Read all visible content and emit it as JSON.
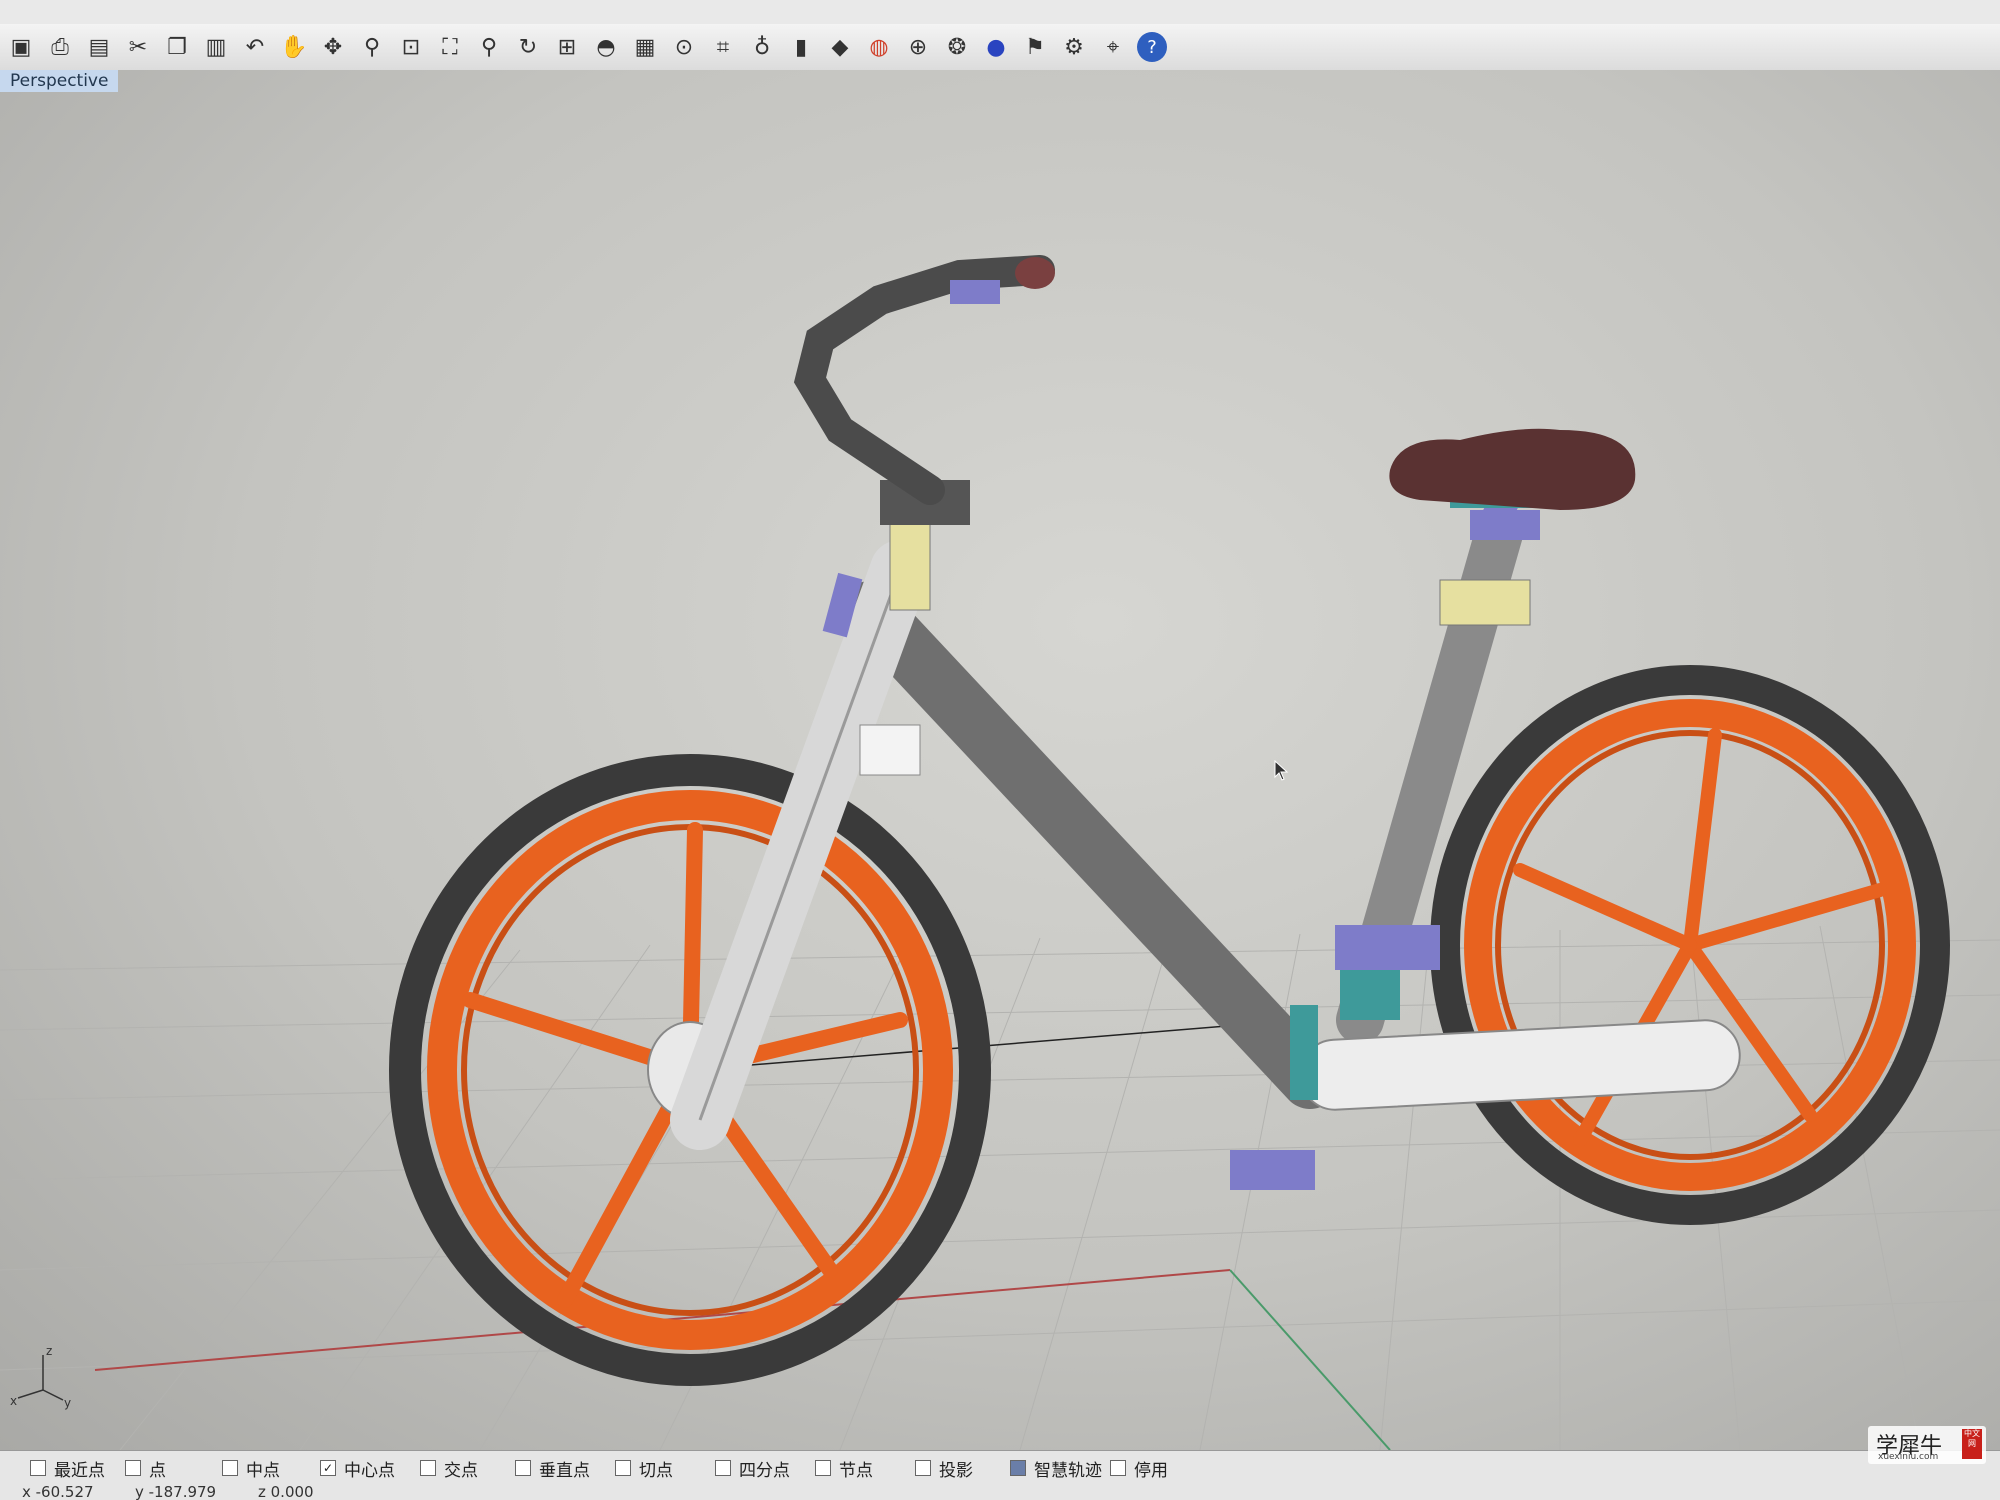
{
  "toolbar": {
    "icons": [
      "save-icon",
      "print-icon",
      "paste-icon",
      "cut-icon",
      "copy-icon",
      "clipboard-icon",
      "undo-icon",
      "pan-hand-icon",
      "rotate-view-icon",
      "zoom-icon",
      "zoom-window-icon",
      "zoom-extents-icon",
      "zoom-selected-icon",
      "rotate-icon",
      "four-viewports-icon",
      "car-icon",
      "grid-plane-icon",
      "cplane-icon",
      "dimension-icon",
      "light-bulb-icon",
      "lock-icon",
      "layer-icon",
      "color-wheel-icon",
      "wireframe-icon",
      "shaded-icon",
      "render-sphere-icon",
      "flag-icon",
      "settings-gear-icon",
      "snap-icon",
      "help-icon"
    ]
  },
  "viewport": {
    "label": "Perspective"
  },
  "axes": {
    "z": "z",
    "x": "x",
    "y": "y"
  },
  "osnaps": [
    {
      "label": "最近点",
      "checked": false
    },
    {
      "label": "点",
      "checked": false
    },
    {
      "label": "中点",
      "checked": false
    },
    {
      "label": "中心点",
      "checked": true
    },
    {
      "label": "交点",
      "checked": false
    },
    {
      "label": "垂直点",
      "checked": false
    },
    {
      "label": "切点",
      "checked": false
    },
    {
      "label": "四分点",
      "checked": false
    },
    {
      "label": "节点",
      "checked": false
    },
    {
      "label": "投影",
      "checked": false
    },
    {
      "label": "智慧轨迹",
      "checked": true
    },
    {
      "label": "停用",
      "checked": false
    }
  ],
  "coords": {
    "x": "x -60.527",
    "y": "y -187.979",
    "z": "z 0.000"
  },
  "watermark": {
    "main": "学犀牛",
    "sub": "xuexiniu.com",
    "badge": "中文网"
  },
  "colors": {
    "wheel": "#e8621f",
    "tire": "#3a3a3a",
    "frame": "#6f6f6f",
    "saddle": "#5a3232",
    "accent_purple": "#7e7cc9",
    "accent_teal": "#3e9a9a"
  }
}
